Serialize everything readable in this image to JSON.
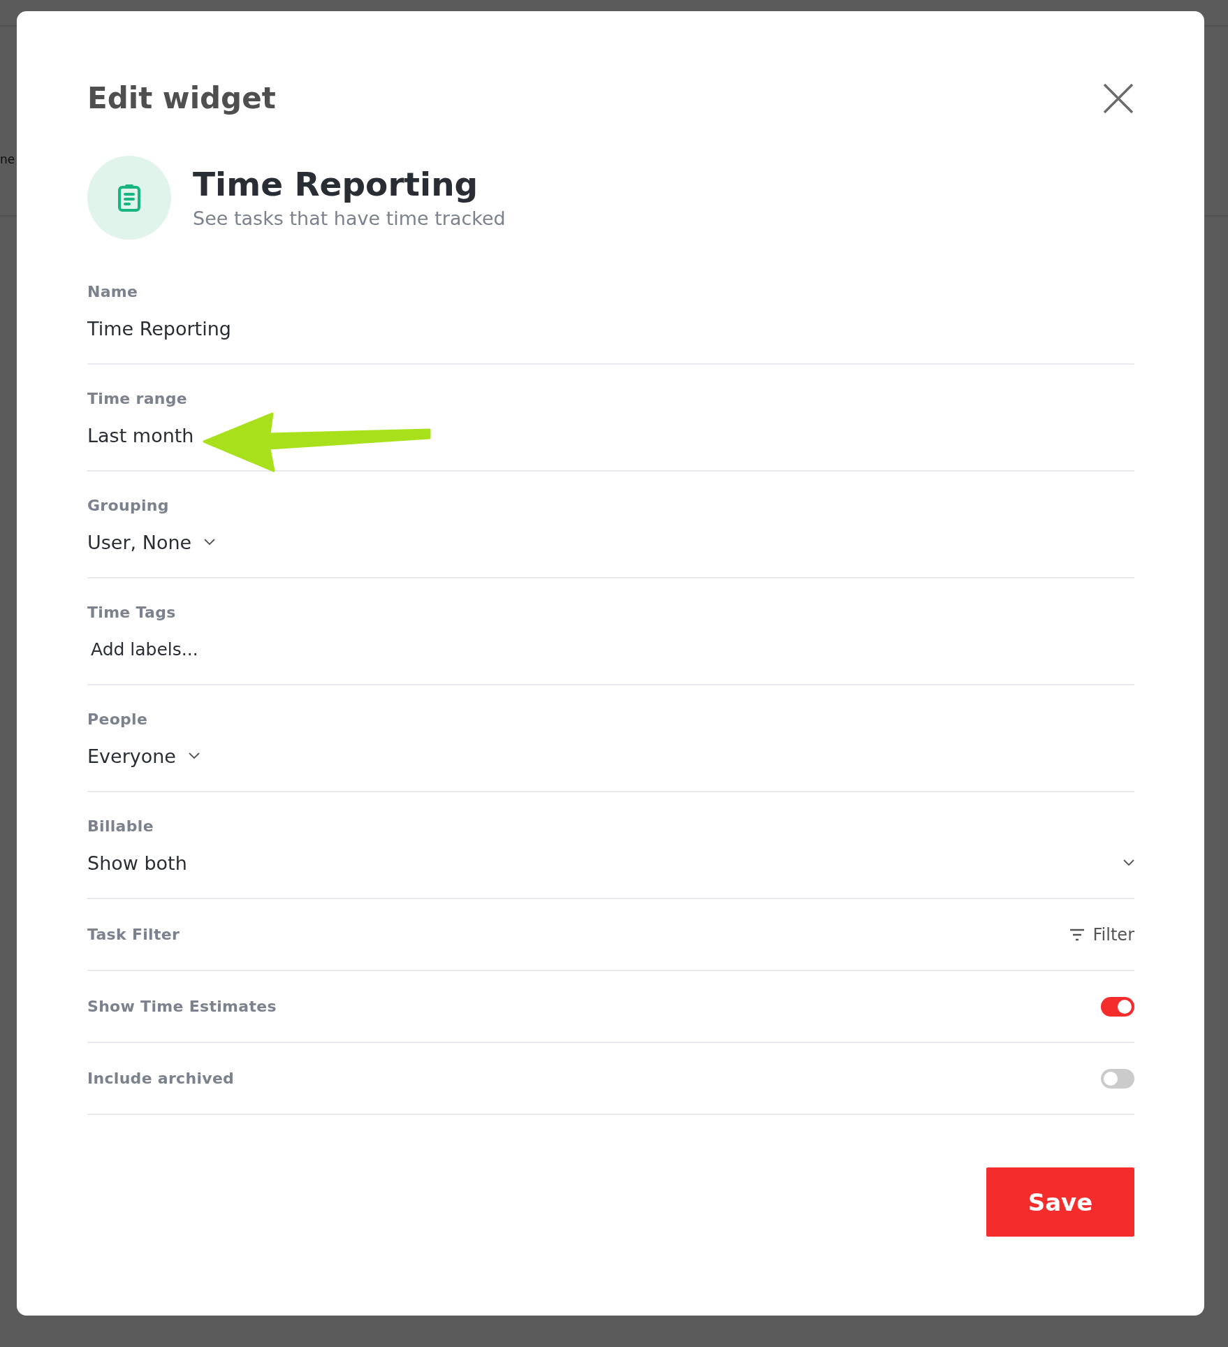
{
  "background_text": "ne",
  "dialog": {
    "title": "Edit widget"
  },
  "widget": {
    "name": "Time Reporting",
    "description": "See tasks that have time tracked"
  },
  "fields": [
    {
      "kind": "text",
      "label": "Name",
      "value": "Time Reporting"
    },
    {
      "kind": "text",
      "label": "Time range",
      "value": "Last month"
    },
    {
      "kind": "select",
      "label": "Grouping",
      "value": "User, None"
    },
    {
      "kind": "labels",
      "label": "Time Tags",
      "placeholder": "Add labels..."
    },
    {
      "kind": "select",
      "label": "People",
      "value": "Everyone"
    },
    {
      "kind": "select_full",
      "label": "Billable",
      "value": "Show both"
    }
  ],
  "options": [
    {
      "kind": "filter",
      "label": "Task Filter",
      "action": "Filter"
    },
    {
      "kind": "toggle",
      "label": "Show Time Estimates",
      "on": true
    },
    {
      "kind": "toggle",
      "label": "Include archived",
      "on": false
    }
  ],
  "save_button": "Save"
}
